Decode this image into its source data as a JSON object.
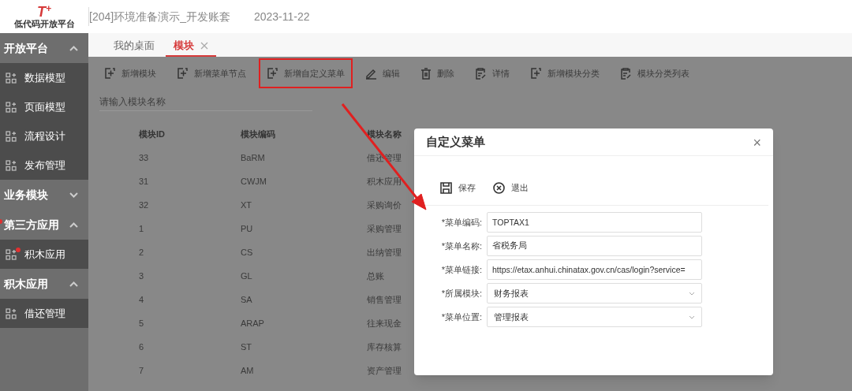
{
  "header": {
    "logo_mark": "T",
    "logo_sup": "+",
    "logo_text": "低代码开放平台",
    "title": "[204]环境准备演示_开发账套",
    "date": "2023-11-22"
  },
  "sidebar": {
    "groups": [
      {
        "label": "开放平台",
        "expanded": true,
        "dot": false,
        "items": [
          {
            "label": "数据模型",
            "dot": false
          },
          {
            "label": "页面模型",
            "dot": false
          },
          {
            "label": "流程设计",
            "dot": false
          },
          {
            "label": "发布管理",
            "dot": false
          }
        ]
      },
      {
        "label": "业务模块",
        "expanded": false,
        "dot": false
      },
      {
        "label": "第三方应用",
        "expanded": true,
        "dot": true,
        "items": [
          {
            "label": "积木应用",
            "dot": true
          }
        ]
      },
      {
        "label": "积木应用",
        "expanded": true,
        "dot": false,
        "items": [
          {
            "label": "借还管理",
            "dot": false
          }
        ]
      }
    ]
  },
  "tabs": [
    {
      "label": "我的桌面",
      "selected": false,
      "closable": false
    },
    {
      "label": "模块",
      "selected": true,
      "closable": true
    }
  ],
  "toolbar": [
    {
      "label": "新增模块",
      "kind": "add",
      "highlighted": false
    },
    {
      "label": "新增菜单节点",
      "kind": "add",
      "highlighted": false
    },
    {
      "label": "新增自定义菜单",
      "kind": "add",
      "highlighted": true
    },
    {
      "label": "编辑",
      "kind": "edit",
      "highlighted": false
    },
    {
      "label": "删除",
      "kind": "delete",
      "highlighted": false
    },
    {
      "label": "详情",
      "kind": "detail",
      "highlighted": false
    },
    {
      "label": "新增模块分类",
      "kind": "add",
      "highlighted": false
    },
    {
      "label": "模块分类列表",
      "kind": "detail",
      "highlighted": false
    }
  ],
  "search": {
    "placeholder": "请输入模块名称"
  },
  "table": {
    "columns": [
      "模块ID",
      "模块编码",
      "模块名称"
    ],
    "rows": [
      [
        "33",
        "BaRM",
        "借还管理"
      ],
      [
        "31",
        "CWJM",
        "积木应用"
      ],
      [
        "32",
        "XT",
        "采购询价"
      ],
      [
        "1",
        "PU",
        "采购管理"
      ],
      [
        "2",
        "CS",
        "出纳管理"
      ],
      [
        "3",
        "GL",
        "总账"
      ],
      [
        "4",
        "SA",
        "销售管理"
      ],
      [
        "5",
        "ARAP",
        "往来现金"
      ],
      [
        "6",
        "ST",
        "库存核算"
      ],
      [
        "7",
        "AM",
        "资产管理"
      ]
    ]
  },
  "dialog": {
    "title": "自定义菜单",
    "close": "×",
    "actions": [
      {
        "label": "保存",
        "kind": "save"
      },
      {
        "label": "退出",
        "kind": "exit"
      }
    ],
    "fields": [
      {
        "label": "*菜单编码:",
        "value": "TOPTAX1",
        "kind": "text"
      },
      {
        "label": "*菜单名称:",
        "value": "省税务局",
        "kind": "text"
      },
      {
        "label": "*菜单链接:",
        "value": "https://etax.anhui.chinatax.gov.cn/cas/login?service=",
        "kind": "text"
      },
      {
        "label": "*所属模块:",
        "value": "财务报表",
        "kind": "select"
      },
      {
        "label": "*菜单位置:",
        "value": "管理报表",
        "kind": "select"
      }
    ]
  }
}
